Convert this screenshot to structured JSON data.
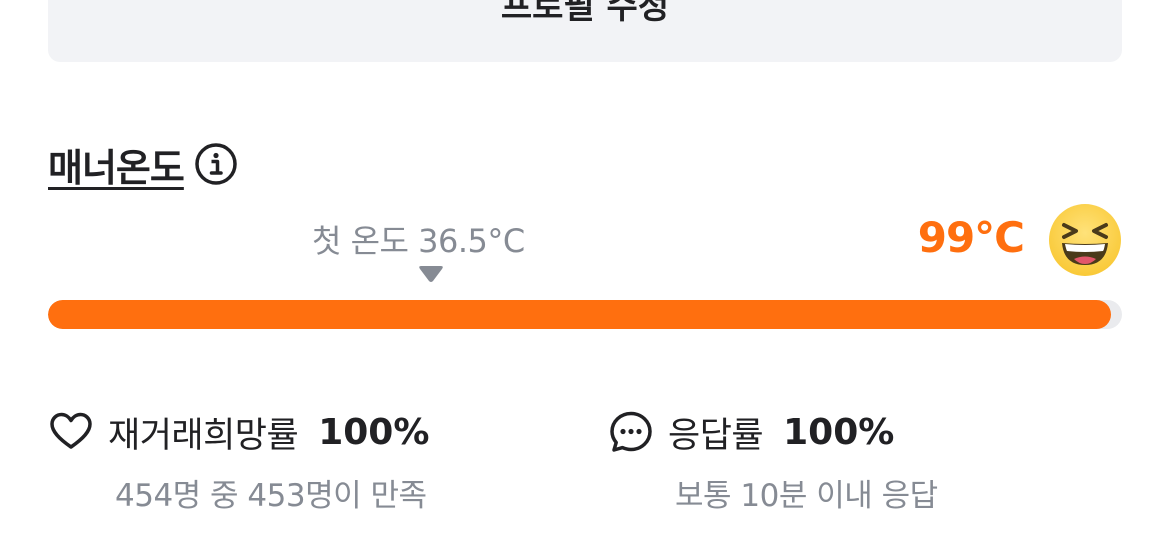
{
  "edit_profile": {
    "label": "프로필 수정"
  },
  "manner": {
    "title": "매너온도",
    "first_temp_label": "첫 온도 36.5°C",
    "current_temp_label": "99°C",
    "progress_fraction": 0.99
  },
  "stats": {
    "rebuy": {
      "label": "재거래희망률",
      "value": "100%",
      "detail": "454명 중 453명이 만족",
      "icon": "heart-icon"
    },
    "response": {
      "label": "응답률",
      "value": "100%",
      "detail": "보통 10분 이내 응답",
      "icon": "chat-bubble-icon"
    }
  },
  "colors": {
    "accent": "#ff6f0f",
    "muted_text": "#868b94",
    "button_bg": "#f2f3f6"
  }
}
